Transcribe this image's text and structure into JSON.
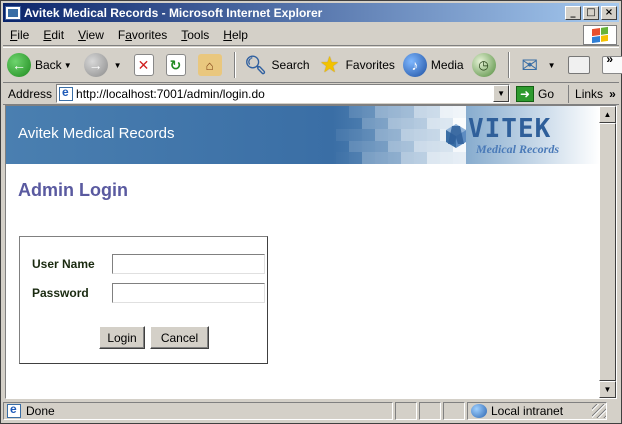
{
  "window": {
    "title": "Avitek Medical Records - Microsoft Internet Explorer",
    "controls": {
      "minimize": "_",
      "maximize": "□",
      "close": "×"
    }
  },
  "menu": [
    {
      "label": "File",
      "key": "F",
      "rest": "ile"
    },
    {
      "label": "Edit",
      "key": "E",
      "rest": "dit"
    },
    {
      "label": "View",
      "key": "V",
      "rest": "iew"
    },
    {
      "label": "Favorites",
      "key": "a",
      "pre": "F",
      "rest": "vorites"
    },
    {
      "label": "Tools",
      "key": "T",
      "rest": "ools"
    },
    {
      "label": "Help",
      "key": "H",
      "rest": "elp"
    }
  ],
  "toolbar": {
    "back_label": "Back",
    "search_label": "Search",
    "favorites_label": "Favorites",
    "media_label": "Media",
    "overflow": "»"
  },
  "address": {
    "label": "Address",
    "url": "http://localhost:7001/admin/login.do",
    "go_label": "Go",
    "links_label": "Links",
    "links_overflow": "»"
  },
  "banner": {
    "title": "Avitek Medical Records",
    "logo_name": "VITEK",
    "logo_sub": "Medical Records"
  },
  "page": {
    "heading": "Admin Login"
  },
  "login": {
    "username_label": "User Name",
    "username_value": "",
    "password_label": "Password",
    "password_value": "",
    "login_button": "Login",
    "cancel_button": "Cancel"
  },
  "status": {
    "text": "Done",
    "zone": "Local intranet"
  },
  "colors": {
    "banner_blue": "#3a6ea5",
    "heading": "#5a5aa0",
    "title_bar": "#0a246a"
  }
}
